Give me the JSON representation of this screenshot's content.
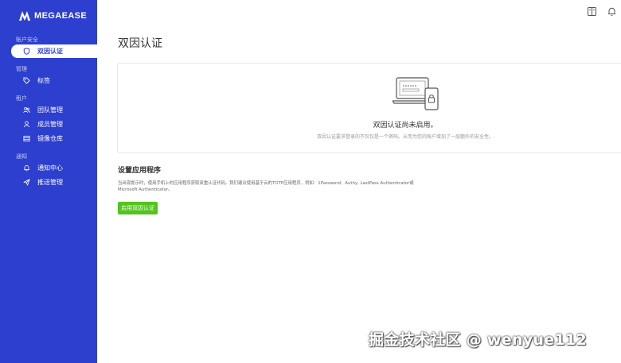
{
  "brand": {
    "name": "MEGAEASE",
    "logo_icon": "megaease-logo-icon"
  },
  "sidebar": {
    "sections": [
      {
        "title": "账户安全",
        "items": [
          {
            "label": "双因认证",
            "icon": "shield-icon",
            "active": true
          }
        ]
      },
      {
        "title": "管理",
        "items": [
          {
            "label": "标签",
            "icon": "tag-icon",
            "active": false
          }
        ]
      },
      {
        "title": "租户",
        "items": [
          {
            "label": "团队管理",
            "icon": "team-icon",
            "active": false
          },
          {
            "label": "成员管理",
            "icon": "user-icon",
            "active": false
          },
          {
            "label": "镜像仓库",
            "icon": "registry-icon",
            "active": false
          }
        ]
      },
      {
        "title": "通知",
        "items": [
          {
            "label": "通知中心",
            "icon": "bell-icon",
            "active": false
          },
          {
            "label": "推送管理",
            "icon": "send-icon",
            "active": false
          }
        ]
      }
    ]
  },
  "topbar": {
    "icons": [
      "book-icon",
      "notification-bell-icon"
    ]
  },
  "page": {
    "title": "双因认证",
    "status_card": {
      "illustration": "laptop-phone-lock-icon",
      "title": "双因认证尚未启用。",
      "description": "双因认证要求登录的不仅仅是一个密码。从而为您的账户增加了一层额外的安全性。"
    },
    "setup": {
      "heading": "设置应用程序",
      "body": "当出现提示时，使用手机上的应用程序获取双重认证代码。我们建议使用基于云的TOTP应用程序，例如：1Password、Authy, LastPass Authenticator或Microsoft Authenticator。",
      "button_label": "启用双因认证"
    }
  },
  "watermark": "掘金技术社区 @ wenyue112",
  "colors": {
    "sidebar": "#2d3fce",
    "accent": "#2d3fce",
    "button": "#52c41a"
  }
}
